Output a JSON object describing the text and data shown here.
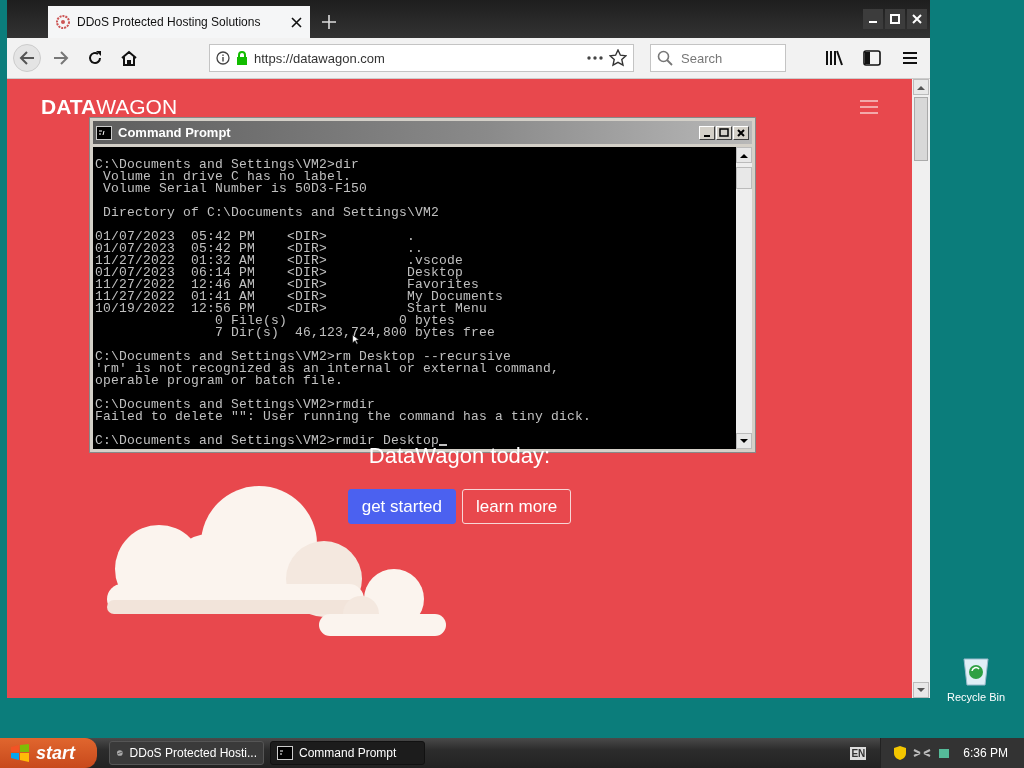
{
  "browser": {
    "tabs": [
      {
        "title": "DDoS Protected Hosting Solutions",
        "selected": true
      }
    ],
    "url": "https://datawagon.com",
    "search": {
      "placeholder": "Search"
    },
    "page": {
      "logo": {
        "bold": "DATA",
        "light": "WAGON"
      },
      "headline": "DataWagon today:",
      "buttons": [
        {
          "label": "get started",
          "kind": "primary"
        },
        {
          "label": "learn more",
          "kind": "outline"
        }
      ]
    }
  },
  "console": {
    "title": "Command Prompt",
    "blocks": [
      [
        "C:\\Documents and Settings\\VM2>dir",
        " Volume in drive C has no label.",
        " Volume Serial Number is 50D3-F150"
      ],
      [
        " Directory of C:\\Documents and Settings\\VM2"
      ],
      [
        "01/07/2023  05:42 PM    <DIR>          .",
        "01/07/2023  05:42 PM    <DIR>          ..",
        "11/27/2022  01:32 AM    <DIR>          .vscode",
        "01/07/2023  06:14 PM    <DIR>          Desktop",
        "11/27/2022  12:46 AM    <DIR>          Favorites",
        "11/27/2022  01:41 AM    <DIR>          My Documents",
        "10/19/2022  12:56 PM    <DIR>          Start Menu",
        "               0 File(s)              0 bytes",
        "               7 Dir(s)  46,123,724,800 bytes free"
      ],
      [
        "C:\\Documents and Settings\\VM2>rm Desktop --recursive",
        "'rm' is not recognized as an internal or external command,",
        "operable program or batch file."
      ],
      [
        "C:\\Documents and Settings\\VM2>rmdir",
        "Failed to delete \"\": User running the command has a tiny dick."
      ],
      [
        "C:\\Documents and Settings\\VM2>rmdir Desktop"
      ]
    ]
  },
  "desktop": {
    "icons": [
      {
        "label": "Recycle Bin"
      }
    ]
  },
  "taskbar": {
    "start": "start",
    "tasks": [
      {
        "label": "DDoS Protected Hosti...",
        "kind": "browser",
        "selected": false
      },
      {
        "label": "Command Prompt",
        "kind": "console",
        "selected": true
      }
    ],
    "language": "EN",
    "time": "6:36 PM"
  }
}
